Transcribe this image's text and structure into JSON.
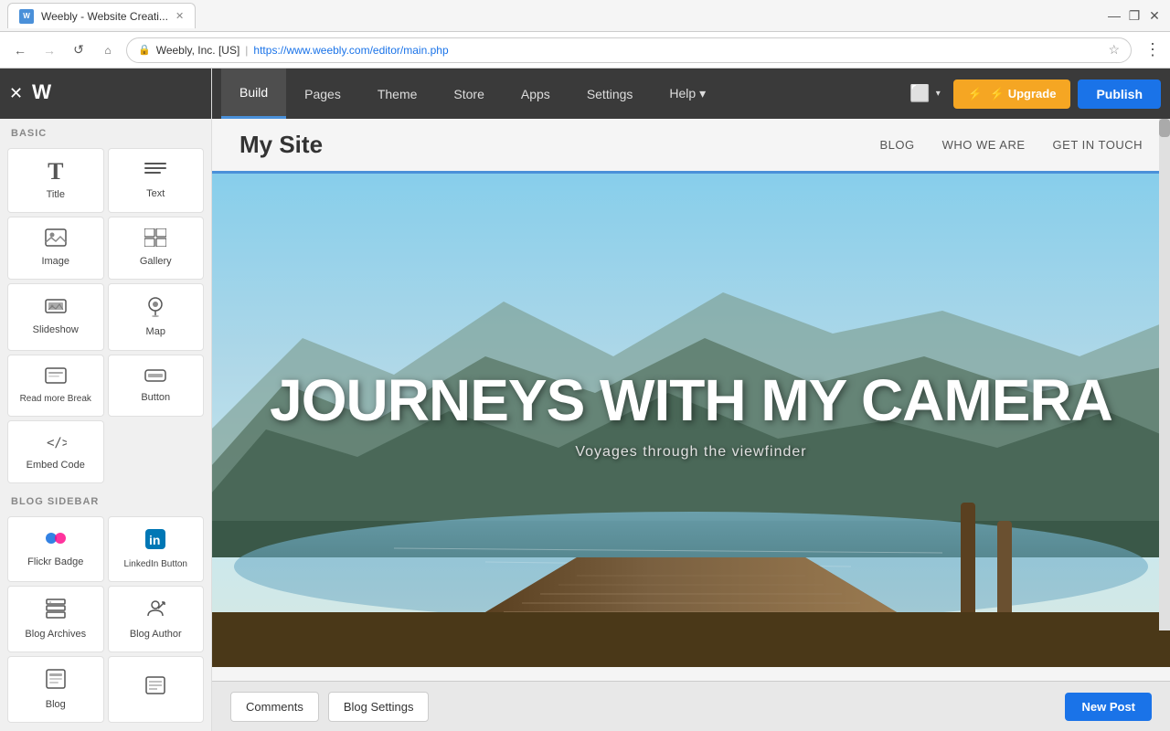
{
  "browser": {
    "tab_title": "Weebly - Website Creati...",
    "favicon": "W",
    "address_lock": "🔒",
    "address_org": "Weebly, Inc. [US]",
    "address_separator": "|",
    "address_url": "https://www.weebly.com/editor/main.php"
  },
  "top_nav": {
    "logo": "W",
    "links": [
      {
        "id": "build",
        "label": "Build",
        "active": true
      },
      {
        "id": "pages",
        "label": "Pages"
      },
      {
        "id": "theme",
        "label": "Theme"
      },
      {
        "id": "store",
        "label": "Store"
      },
      {
        "id": "apps",
        "label": "Apps"
      },
      {
        "id": "settings",
        "label": "Settings"
      },
      {
        "id": "help",
        "label": "Help ▾"
      }
    ],
    "preview_icon": "⬜",
    "upgrade_label": "⚡ Upgrade",
    "publish_label": "Publish"
  },
  "sidebar": {
    "close_icon": "✕",
    "sections": [
      {
        "id": "basic",
        "label": "BASIC",
        "items": [
          {
            "id": "title",
            "label": "Title",
            "icon": "T"
          },
          {
            "id": "text",
            "label": "Text",
            "icon": "≡"
          },
          {
            "id": "image",
            "label": "Image",
            "icon": "img"
          },
          {
            "id": "gallery",
            "label": "Gallery",
            "icon": "gal"
          },
          {
            "id": "slideshow",
            "label": "Slideshow",
            "icon": "sld"
          },
          {
            "id": "map",
            "label": "Map",
            "icon": "map"
          },
          {
            "id": "read-more",
            "label": "Read more Break",
            "icon": "brk"
          },
          {
            "id": "button",
            "label": "Button",
            "icon": "btn"
          },
          {
            "id": "embed-code",
            "label": "Embed Code",
            "icon": "</>"
          }
        ]
      },
      {
        "id": "blog-sidebar",
        "label": "BLOG SIDEBAR",
        "items": [
          {
            "id": "flickr-badge",
            "label": "Flickr Badge",
            "icon": "flk"
          },
          {
            "id": "linkedin-button",
            "label": "LinkedIn Button",
            "icon": "in"
          },
          {
            "id": "blog-archives",
            "label": "Blog Archives",
            "icon": "arc"
          },
          {
            "id": "blog-author",
            "label": "Blog Author",
            "icon": "aut"
          },
          {
            "id": "blog-bottom-1",
            "label": "Blog",
            "icon": "blg"
          },
          {
            "id": "blog-bottom-2",
            "label": "",
            "icon": "lst"
          }
        ]
      }
    ]
  },
  "website": {
    "site_title": "My Site",
    "nav_links": [
      "BLOG",
      "WHO WE ARE",
      "GET IN TOUCH"
    ],
    "hero_title": "JOURNEYS WITH MY CAMERA",
    "hero_subtitle": "Voyages through the viewfinder"
  },
  "bottom_bar": {
    "comments_label": "Comments",
    "blog_settings_label": "Blog Settings",
    "new_post_label": "New Post"
  }
}
